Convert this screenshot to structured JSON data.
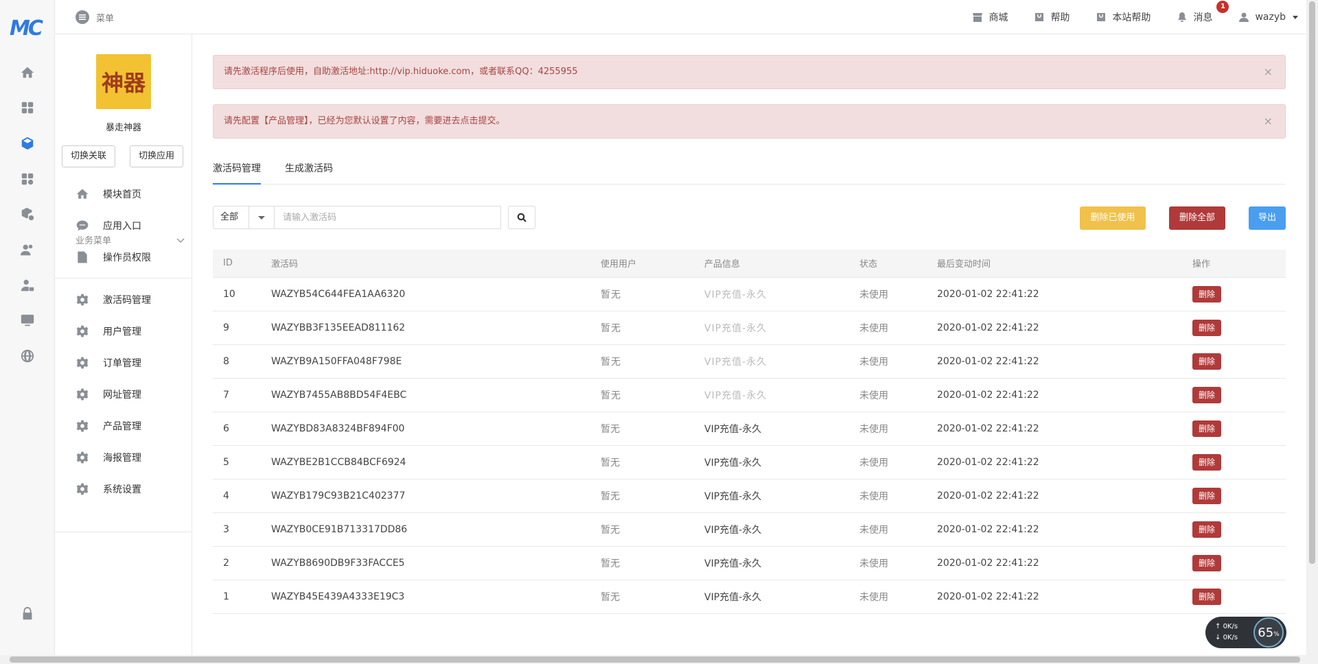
{
  "logo": "MC",
  "topbar": {
    "menu_label": "菜单",
    "items": [
      {
        "label": "商城"
      },
      {
        "label": "帮助"
      },
      {
        "label": "本站帮助"
      },
      {
        "label": "消息"
      },
      {
        "label": "wazyb"
      }
    ],
    "message_badge": "1"
  },
  "sidebar": {
    "app_logo_text": "神器",
    "app_name": "暴走神器",
    "switch_link": "切换关联",
    "switch_app": "切换应用",
    "nav": [
      {
        "label": "模块首页"
      },
      {
        "label": "应用入口"
      },
      {
        "label": "操作员权限"
      }
    ],
    "section_title": "业务菜单",
    "business": [
      {
        "label": "激活码管理"
      },
      {
        "label": "用户管理"
      },
      {
        "label": "订单管理"
      },
      {
        "label": "网址管理"
      },
      {
        "label": "产品管理"
      },
      {
        "label": "海报管理"
      },
      {
        "label": "系统设置"
      }
    ]
  },
  "alerts": [
    {
      "text": "请先激活程序后使用，自助激活地址:http://vip.hiduoke.com，或者联系QQ：4255955"
    },
    {
      "text": "请先配置【产品管理】，已经为您默认设置了内容，需要进去点击提交。"
    }
  ],
  "tabs": [
    {
      "label": "激活码管理"
    },
    {
      "label": "生成激活码"
    }
  ],
  "filter": {
    "select_value": "全部",
    "search_placeholder": "请输入激活码"
  },
  "actions": {
    "delete_used": "删除已使用",
    "delete_all": "删除全部",
    "export": "导出"
  },
  "table": {
    "headers": [
      "ID",
      "激活码",
      "使用用户",
      "产品信息",
      "状态",
      "最后变动时间",
      "操作"
    ],
    "delete_label": "删除",
    "rows": [
      {
        "id": "10",
        "code": "WAZYB54C644FEA1AA6320",
        "user": "暂无",
        "product": "VIP充值-永久",
        "status": "未使用",
        "time": "2020-01-02 22:41:22"
      },
      {
        "id": "9",
        "code": "WAZYBB3F135EEAD811162",
        "user": "暂无",
        "product": "VIP充值-永久",
        "status": "未使用",
        "time": "2020-01-02 22:41:22"
      },
      {
        "id": "8",
        "code": "WAZYB9A150FFA048F798E",
        "user": "暂无",
        "product": "VIP充值-永久",
        "status": "未使用",
        "time": "2020-01-02 22:41:22"
      },
      {
        "id": "7",
        "code": "WAZYB7455AB8BD54F4EBC",
        "user": "暂无",
        "product": "VIP充值-永久",
        "status": "未使用",
        "time": "2020-01-02 22:41:22"
      },
      {
        "id": "6",
        "code": "WAZYBD83A8324BF894F00",
        "user": "暂无",
        "product": "VIP充值-永久",
        "status": "未使用",
        "time": "2020-01-02 22:41:22"
      },
      {
        "id": "5",
        "code": "WAZYBE2B1CCB84BCF6924",
        "user": "暂无",
        "product": "VIP充值-永久",
        "status": "未使用",
        "time": "2020-01-02 22:41:22"
      },
      {
        "id": "4",
        "code": "WAZYB179C93B21C402377",
        "user": "暂无",
        "product": "VIP充值-永久",
        "status": "未使用",
        "time": "2020-01-02 22:41:22"
      },
      {
        "id": "3",
        "code": "WAZYB0CE91B713317DD86",
        "user": "暂无",
        "product": "VIP充值-永久",
        "status": "未使用",
        "time": "2020-01-02 22:41:22"
      },
      {
        "id": "2",
        "code": "WAZYB8690DB9F33FACCE5",
        "user": "暂无",
        "product": "VIP充值-永久",
        "status": "未使用",
        "time": "2020-01-02 22:41:22"
      },
      {
        "id": "1",
        "code": "WAZYB45E439A4333E19C3",
        "user": "暂无",
        "product": "VIP充值-永久",
        "status": "未使用",
        "time": "2020-01-02 22:41:22"
      }
    ]
  },
  "net_widget": {
    "up": "0K/s",
    "down": "0K/s",
    "percent": "65",
    "percent_unit": "%"
  },
  "colors": {
    "primary": "#2f7be0",
    "warning": "#f0c14b",
    "danger": "#b03a3a",
    "info": "#4a9ef0",
    "alert_bg": "#f2dede",
    "alert_text": "#a94442"
  }
}
